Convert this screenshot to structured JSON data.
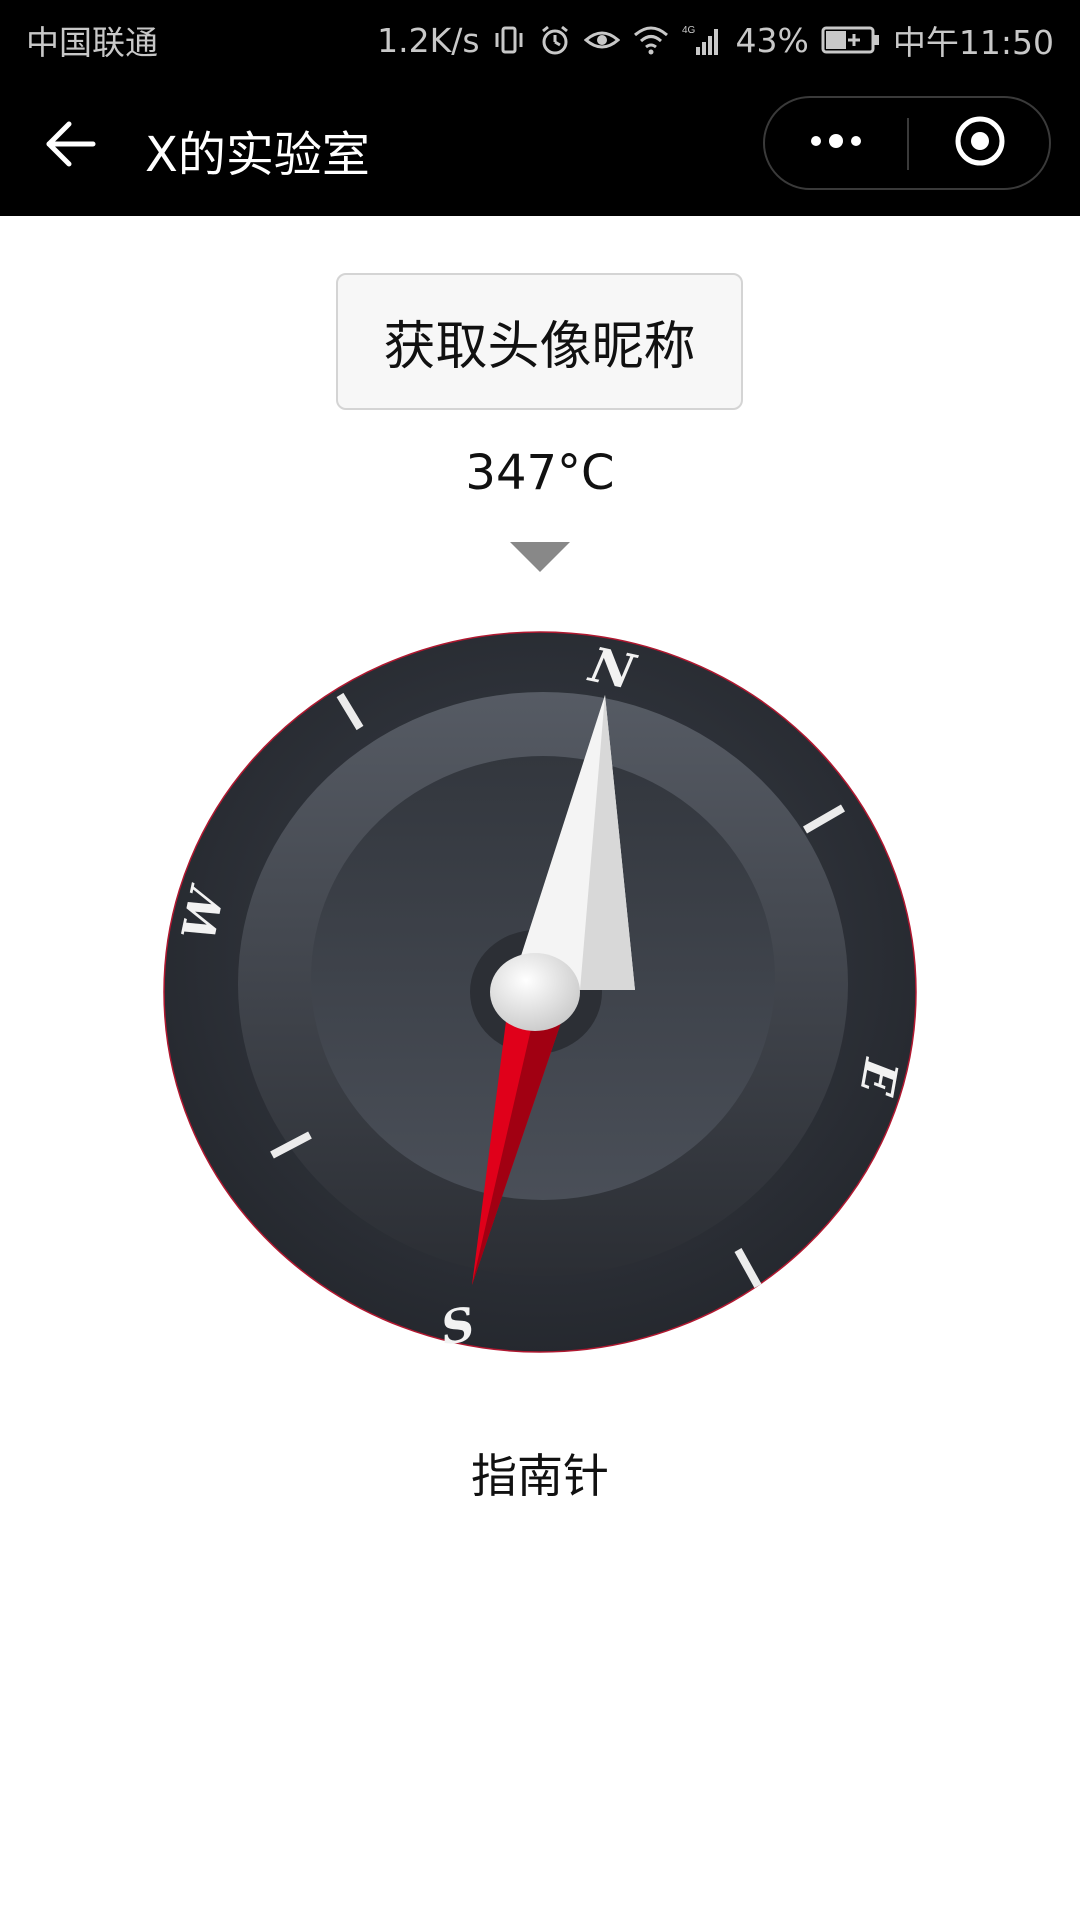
{
  "status_bar": {
    "carrier": "中国联通",
    "net_speed": "1.2K/s",
    "network_type": "4G",
    "battery": "43%",
    "time": "中午11:50",
    "icons": [
      "vibrate-icon",
      "alarm-icon",
      "eye-icon",
      "wifi-icon",
      "signal-icon",
      "battery-charging-icon"
    ]
  },
  "nav": {
    "title": "X的实验室",
    "back_icon": "arrow-left-icon",
    "more_icon": "more-dots-icon",
    "close_icon": "target-circle-icon"
  },
  "main": {
    "avatar_button_label": "获取头像昵称",
    "heading_readout": "347°C",
    "compass": {
      "cardinals": {
        "north": "N",
        "east": "E",
        "south": "S",
        "west": "W"
      },
      "heading_degrees": 347,
      "needle_north_color": "#f4f4f4",
      "needle_south_color": "#e0001a"
    },
    "compass_label": "指南针"
  },
  "colors": {
    "bar_background": "#000000",
    "page_background": "#ffffff",
    "dial_outer": "#2c2f36",
    "dial_inner": "#3e434c",
    "marker": "#888888"
  }
}
